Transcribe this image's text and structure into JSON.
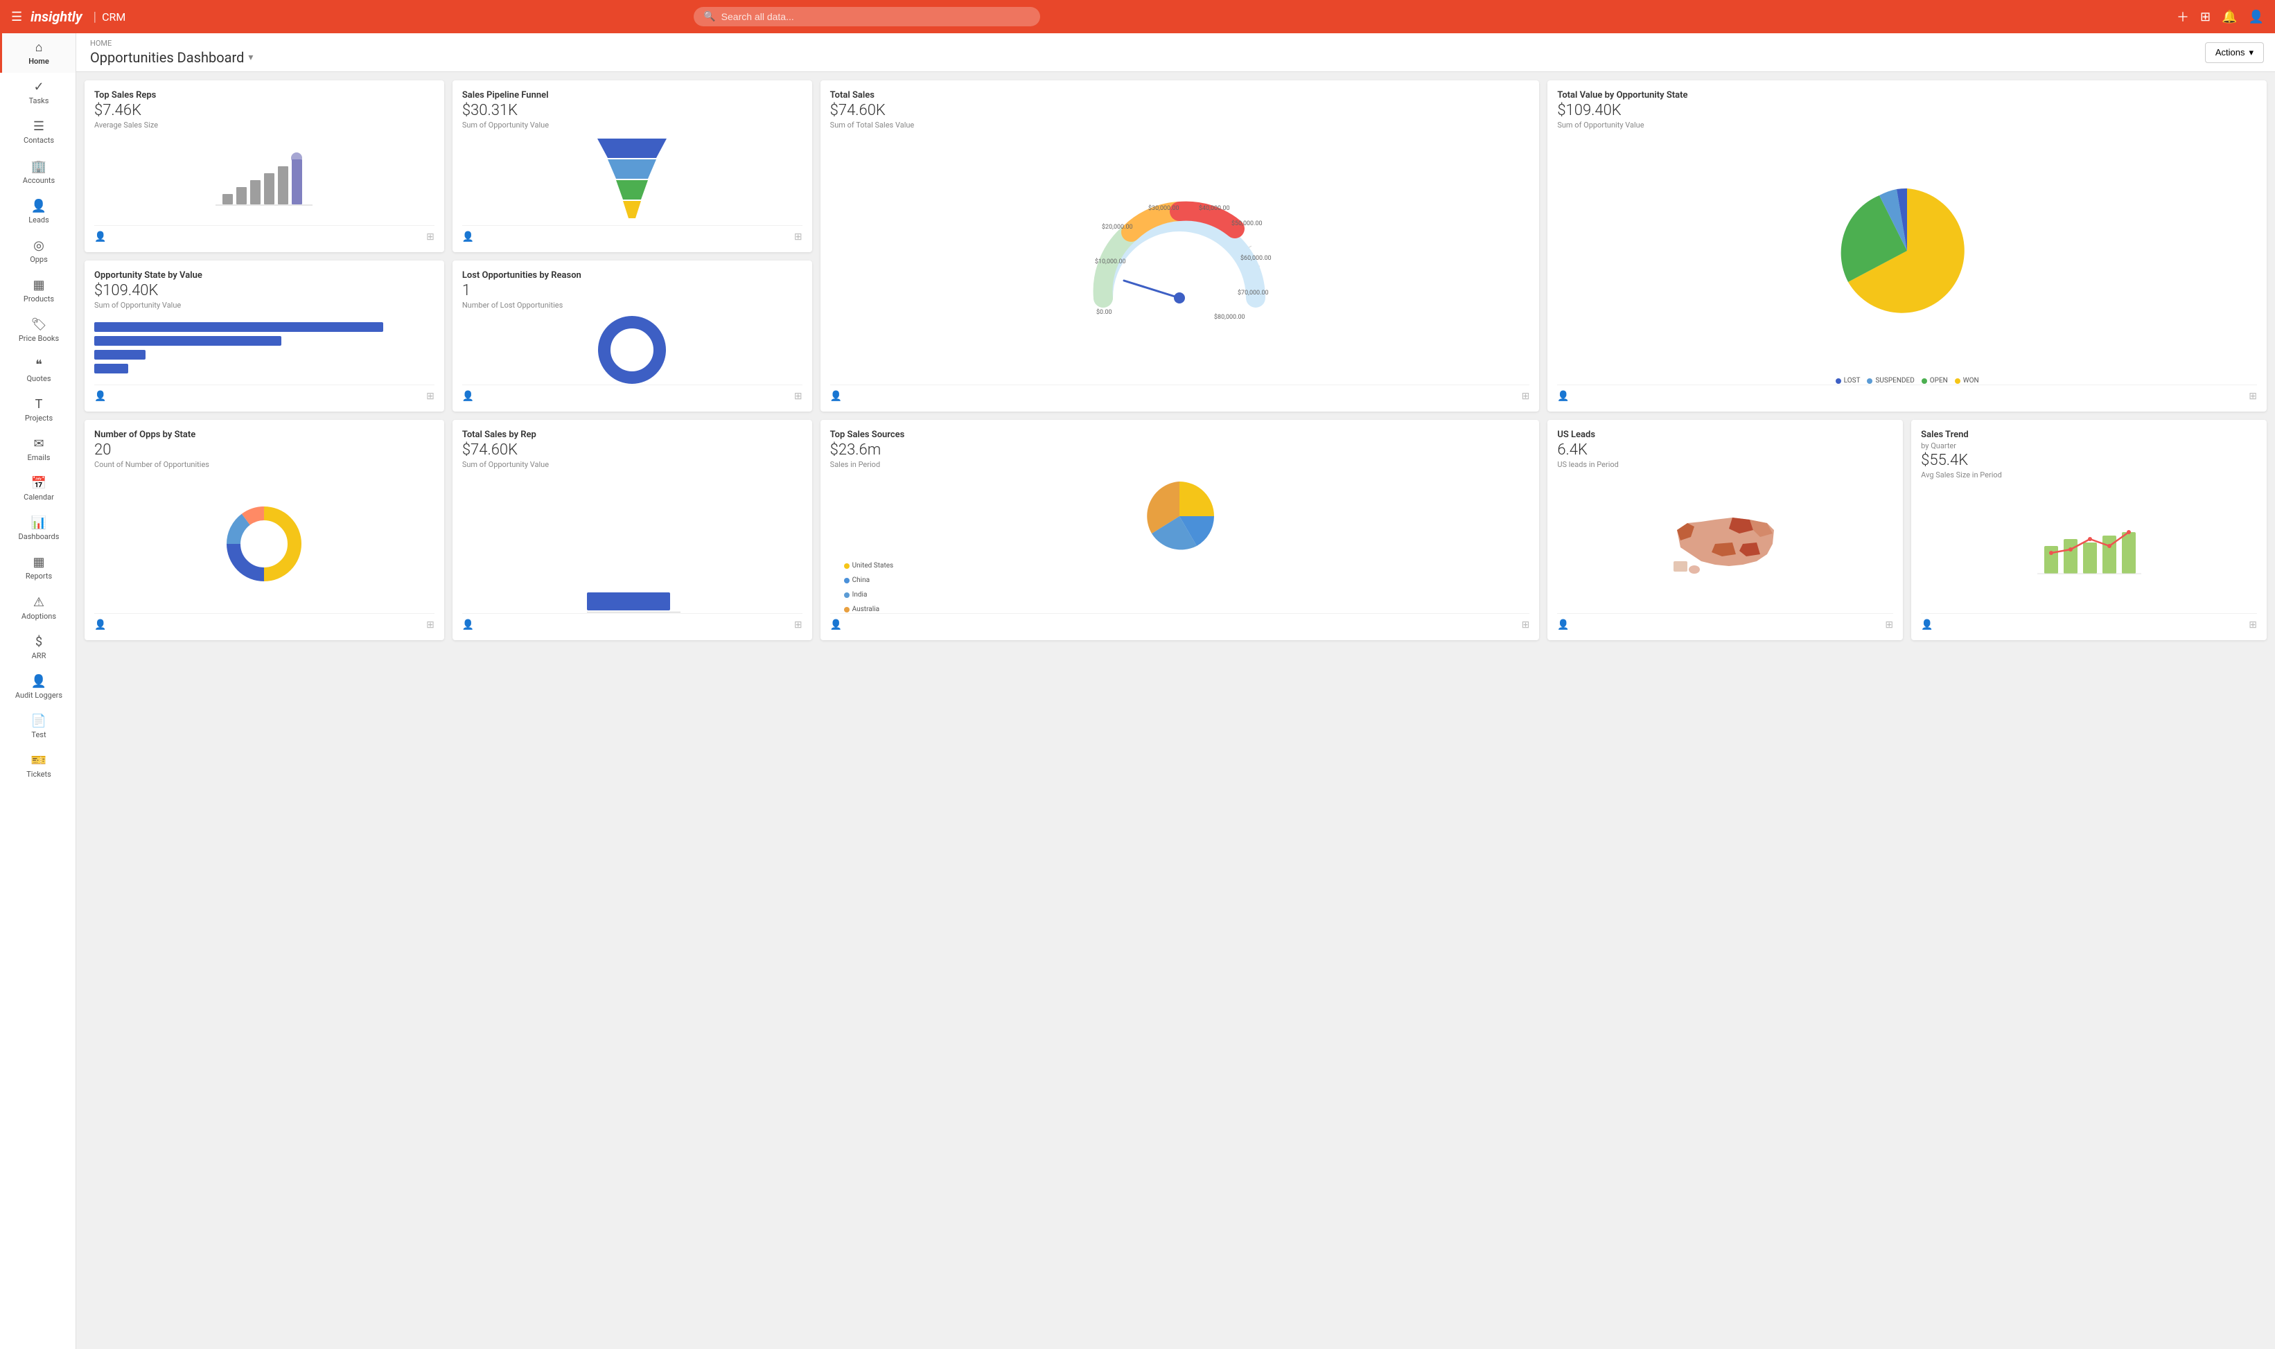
{
  "app": {
    "logo": "insightly",
    "product": "CRM",
    "search_placeholder": "Search all data..."
  },
  "header": {
    "breadcrumb": "HOME",
    "title": "Opportunities Dashboard",
    "actions_label": "Actions"
  },
  "sidebar": {
    "items": [
      {
        "id": "home",
        "label": "Home",
        "icon": "⌂",
        "active": true
      },
      {
        "id": "tasks",
        "label": "Tasks",
        "icon": "✓"
      },
      {
        "id": "contacts",
        "label": "Contacts",
        "icon": "☰"
      },
      {
        "id": "accounts",
        "label": "Accounts",
        "icon": "🏢"
      },
      {
        "id": "leads",
        "label": "Leads",
        "icon": "👤"
      },
      {
        "id": "opps",
        "label": "Opps",
        "icon": "◎"
      },
      {
        "id": "products",
        "label": "Products",
        "icon": "▦"
      },
      {
        "id": "price-books",
        "label": "Price Books",
        "icon": "🏷"
      },
      {
        "id": "quotes",
        "label": "Quotes",
        "icon": "⟨⟩"
      },
      {
        "id": "projects",
        "label": "Projects",
        "icon": "T"
      },
      {
        "id": "emails",
        "label": "Emails",
        "icon": "✉"
      },
      {
        "id": "calendar",
        "label": "Calendar",
        "icon": "▦"
      },
      {
        "id": "dashboards",
        "label": "Dashboards",
        "icon": "⬛"
      },
      {
        "id": "reports",
        "label": "Reports",
        "icon": "▦"
      },
      {
        "id": "adoptions",
        "label": "Adoptions",
        "icon": "⚠"
      },
      {
        "id": "arr",
        "label": "ARR",
        "icon": "$"
      },
      {
        "id": "audit",
        "label": "Audit Loggers",
        "icon": "👤"
      },
      {
        "id": "test",
        "label": "Test",
        "icon": "📄"
      },
      {
        "id": "tickets",
        "label": "Tickets",
        "icon": "🎫"
      }
    ]
  },
  "cards": {
    "top_sales_reps": {
      "title": "Top Sales Reps",
      "value": "$7.46K",
      "subtitle": "Average Sales Size"
    },
    "sales_pipeline": {
      "title": "Sales Pipeline Funnel",
      "value": "$30.31K",
      "subtitle": "Sum of Opportunity Value"
    },
    "total_sales": {
      "title": "Total Sales",
      "value": "$74.60K",
      "subtitle": "Sum of Total Sales Value"
    },
    "total_value_by_state": {
      "title": "Total Value by Opportunity State",
      "value": "$109.40K",
      "subtitle": "Sum of Opportunity Value",
      "legend": [
        {
          "label": "LOST",
          "color": "#3d5fc4"
        },
        {
          "label": "SUSPENDED",
          "color": "#5b9bd5"
        },
        {
          "label": "OPEN",
          "color": "#4caf50"
        },
        {
          "label": "WON",
          "color": "#f5c518"
        }
      ]
    },
    "opp_state_by_value": {
      "title": "Opportunity State by Value",
      "value": "$109.40K",
      "subtitle": "Sum of Opportunity Value",
      "bars": [
        {
          "label": "",
          "pct": 85
        },
        {
          "label": "",
          "pct": 55
        },
        {
          "label": "",
          "pct": 15
        },
        {
          "label": "",
          "pct": 10
        }
      ]
    },
    "lost_opps": {
      "title": "Lost Opportunities by Reason",
      "value": "1",
      "subtitle": "Number of Lost Opportunities"
    },
    "num_opps_by_state": {
      "title": "Number of Opps by State",
      "value": "20",
      "subtitle": "Count of Number of Opportunities"
    },
    "total_sales_by_rep": {
      "title": "Total Sales by Rep",
      "value": "$74.60K",
      "subtitle": "Sum of Opportunity Value"
    },
    "top_sales_sources": {
      "title": "Top Sales Sources",
      "value": "$23.6m",
      "subtitle": "Sales in Period",
      "legend": [
        {
          "label": "United States",
          "color": "#f5c518"
        },
        {
          "label": "China",
          "color": "#4a90d9"
        },
        {
          "label": "India",
          "color": "#5b9bd5"
        },
        {
          "label": "Australia",
          "color": "#e8a040"
        }
      ]
    },
    "us_leads": {
      "title": "US Leads",
      "value": "6.4K",
      "subtitle": "US leads in Period"
    },
    "sales_trend": {
      "title": "Sales Trend",
      "subtitle_main": "by Quarter",
      "value": "$55.4K",
      "subtitle": "Avg Sales Size in Period"
    }
  }
}
